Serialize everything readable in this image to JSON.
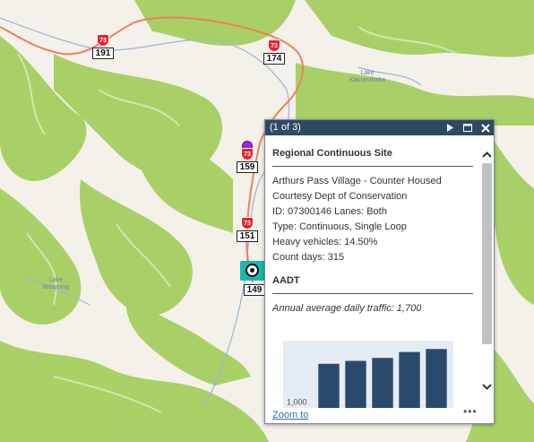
{
  "map": {
    "shields": [
      {
        "route": "73",
        "km": "191"
      },
      {
        "route": "73",
        "km": "174"
      },
      {
        "route": "73",
        "km": "159"
      },
      {
        "route": "73",
        "km": "151"
      },
      {
        "route": "73",
        "km": "149"
      }
    ],
    "places": [
      {
        "line1": "Lake",
        "line2": "Kaurarahaka"
      },
      {
        "line1": "Lake",
        "line2": "Browning"
      }
    ],
    "icons": {
      "road": "highway-line",
      "pin": "purple-dot-marker",
      "selected": "counter-site-marker"
    },
    "colors": {
      "land": "#f4f1ea",
      "forest": "#a5cf5f",
      "highway": "#f07f5d",
      "river": "#9cb4d8",
      "pin": "#9a2bd1",
      "selected": "#19b8b0"
    }
  },
  "popup": {
    "counter": "(1 of 3)",
    "buttons": {
      "next_icon": "play-next-icon",
      "maximize_icon": "maximize-icon",
      "close_icon": "close-icon"
    },
    "site_title": "Regional Continuous Site",
    "attributes": [
      "Arthurs Pass Village - Counter Housed",
      "Courtesy Dept of Conservation",
      "ID: 07300146 Lanes: Both",
      "Type: Continuous, Single Loop",
      "Heavy vehicles: 14.50%",
      "Count days: 315"
    ],
    "aadt_title": "AADT",
    "chart_caption": "Annual average daily traffic: 1,700",
    "zoom_label": "Zoom to",
    "more_label": "•••",
    "colors": {
      "titlebar": "#2e4a63",
      "bar": "#2a4a6d",
      "link": "#2b6cb5"
    }
  },
  "chart_data": {
    "type": "bar",
    "categories": [
      "",
      "",
      "",
      "",
      ""
    ],
    "values": [
      1650,
      1700,
      1750,
      1850,
      1900
    ],
    "ylabel": "",
    "tick_labels": [
      "1,000"
    ],
    "ylim": [
      600,
      1950
    ],
    "grid": true
  }
}
